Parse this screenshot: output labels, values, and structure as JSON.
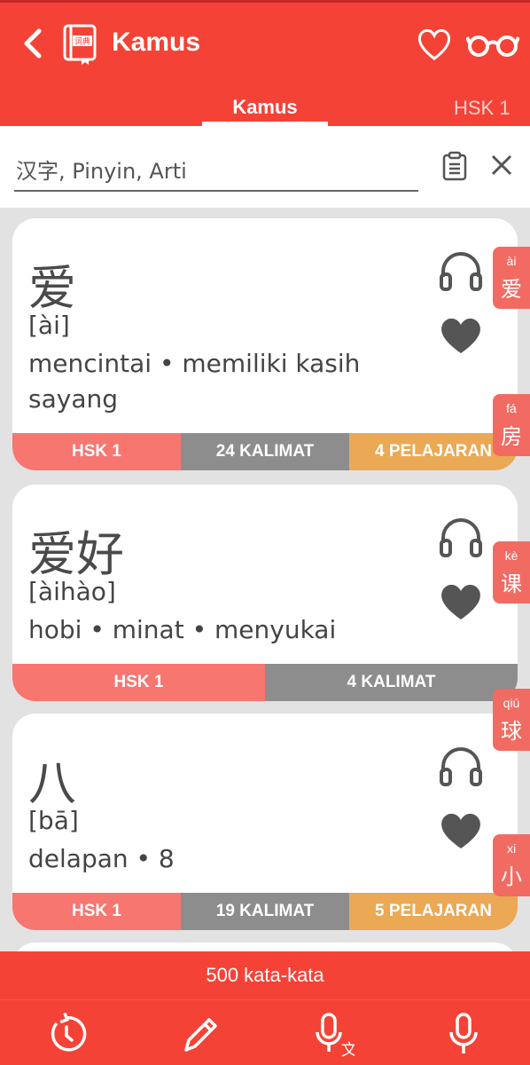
{
  "appbar": {
    "title": "Kamus",
    "book_badge": "词典",
    "colors": {
      "primary": "#f44336",
      "tag_hsk": "#f87670",
      "tag_kalimat": "#8d8d8d",
      "tag_pelajaran": "#eba855"
    }
  },
  "icons": [
    "chevron-left-icon",
    "dictionary-book-icon",
    "heart-icon",
    "glasses-icon",
    "clipboard-icon",
    "close-icon",
    "headphones-icon",
    "heart-filled-icon",
    "history-icon",
    "pencil-icon",
    "mic-translate-icon",
    "mic-icon"
  ],
  "tabs": [
    {
      "label": "Kamus",
      "active": true
    },
    {
      "label": "HSK 1",
      "active": false
    }
  ],
  "search": {
    "placeholder": "汉字, Pinyin, Arti",
    "value": ""
  },
  "entries": [
    {
      "hanzi": "爱",
      "pinyin": "[ài]",
      "meaning": "mencintai • memiliki kasih sayang",
      "hsk": "HSK 1",
      "sentences": "24 KALIMAT",
      "lessons": "4 PELAJARAN"
    },
    {
      "hanzi": "爱好",
      "pinyin": "[àihào]",
      "meaning": "hobi • minat • menyukai",
      "hsk": "HSK 1",
      "sentences": "4 KALIMAT",
      "lessons": ""
    },
    {
      "hanzi": "八",
      "pinyin": "[bā]",
      "meaning": "delapan • 8",
      "hsk": "HSK 1",
      "sentences": "19 KALIMAT",
      "lessons": "5 PELAJARAN"
    }
  ],
  "side_index": [
    {
      "pinyin": "ài",
      "hanzi": "爱"
    },
    {
      "pinyin": "fá",
      "hanzi": "房"
    },
    {
      "pinyin": "kè",
      "hanzi": "课"
    },
    {
      "pinyin": "qiú",
      "hanzi": "球"
    },
    {
      "pinyin": "xi",
      "hanzi": "小"
    }
  ],
  "footer": {
    "count_label": "500 kata-kata"
  }
}
